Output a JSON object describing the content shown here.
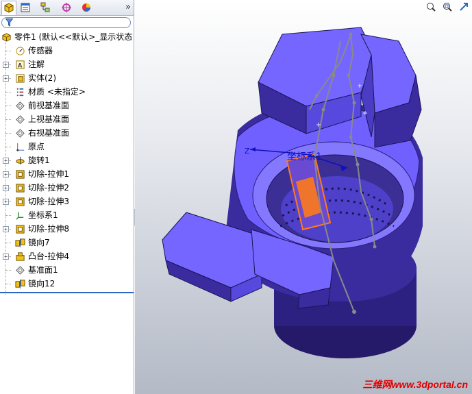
{
  "feature_tree": {
    "items": [
      {
        "label": "零件1  (默认<<默认>_显示状态",
        "icon": "part-icon",
        "expand": false
      },
      {
        "label": "传感器",
        "icon": "sensor-icon",
        "expand": false
      },
      {
        "label": "注解",
        "icon": "annotation-icon",
        "expand": true
      },
      {
        "label": "实体(2)",
        "icon": "solid-bodies-icon",
        "expand": true
      },
      {
        "label": "材质 <未指定>",
        "icon": "material-icon",
        "expand": false
      },
      {
        "label": "前视基准面",
        "icon": "plane-icon",
        "expand": false
      },
      {
        "label": "上视基准面",
        "icon": "plane-icon",
        "expand": false
      },
      {
        "label": "右视基准面",
        "icon": "plane-icon",
        "expand": false
      },
      {
        "label": "原点",
        "icon": "origin-icon",
        "expand": false
      },
      {
        "label": "旋转1",
        "icon": "revolve-icon",
        "expand": true
      },
      {
        "label": "切除-拉伸1",
        "icon": "cut-extrude-icon",
        "expand": true
      },
      {
        "label": "切除-拉伸2",
        "icon": "cut-extrude-icon",
        "expand": true
      },
      {
        "label": "切除-拉伸3",
        "icon": "cut-extrude-icon",
        "expand": true
      },
      {
        "label": "坐标系1",
        "icon": "coordinate-system-icon",
        "expand": false
      },
      {
        "label": "切除-拉伸8",
        "icon": "cut-extrude-icon",
        "expand": true
      },
      {
        "label": "镜向7",
        "icon": "mirror-icon",
        "expand": false
      },
      {
        "label": "凸台-拉伸4",
        "icon": "boss-extrude-icon",
        "expand": true
      },
      {
        "label": "基准面1",
        "icon": "plane-icon",
        "expand": false
      },
      {
        "label": "镜向12",
        "icon": "mirror-icon",
        "expand": false
      }
    ]
  },
  "tabs": [
    "feature-manager-tab",
    "property-manager-tab",
    "configuration-manager-tab",
    "dimxpert-tab",
    "display-manager-tab"
  ],
  "viewport": {
    "coord_label": "坐标系1",
    "axis_label": "Z",
    "watermark": "三维网www.3dportal.cn"
  },
  "colors": {
    "model_face": "#6f60ff",
    "model_dark": "#2a1e7a",
    "model_mid": "#4b3cc4",
    "sketch": "#8a8a8a",
    "highlight": "#ff7a1a",
    "watermark": "#e00000"
  }
}
